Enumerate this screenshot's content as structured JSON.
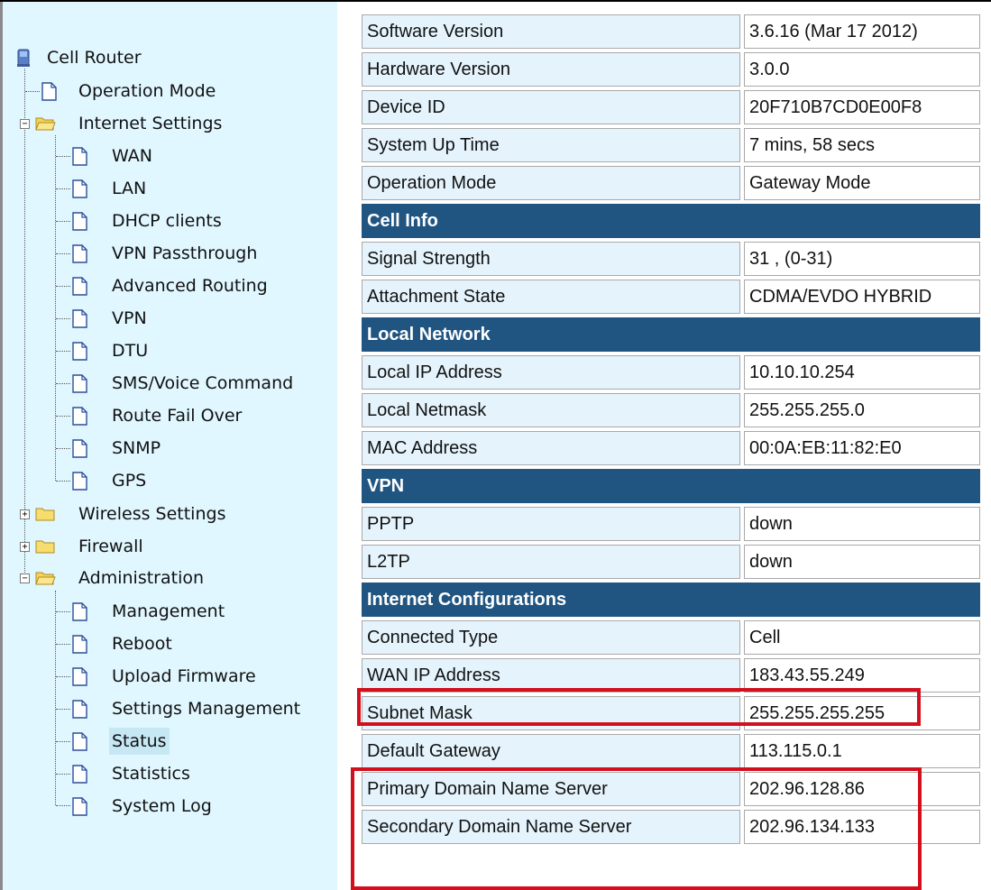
{
  "sidebar": {
    "root": "Cell Router",
    "items": [
      {
        "label": "Operation Mode"
      },
      {
        "label": "Internet Settings",
        "children": [
          "WAN",
          "LAN",
          "DHCP clients",
          "VPN Passthrough",
          "Advanced Routing",
          "VPN",
          "DTU",
          "SMS/Voice Command",
          "Route Fail Over",
          "SNMP",
          "GPS"
        ]
      },
      {
        "label": "Wireless Settings"
      },
      {
        "label": "Firewall"
      },
      {
        "label": "Administration",
        "children": [
          "Management",
          "Reboot",
          "Upload Firmware",
          "Settings Management",
          "Status",
          "Statistics",
          "System Log"
        ]
      }
    ],
    "selected": "Status"
  },
  "system_info": [
    {
      "label": "Software Version",
      "value": "3.6.16 (Mar 17 2012)"
    },
    {
      "label": "Hardware Version",
      "value": "3.0.0"
    },
    {
      "label": "Device ID",
      "value": "20F710B7CD0E00F8"
    },
    {
      "label": "System Up Time",
      "value": "7 mins, 58 secs"
    },
    {
      "label": "Operation Mode",
      "value": "Gateway Mode"
    }
  ],
  "cell_info": {
    "title": "Cell Info",
    "rows": [
      {
        "label": "Signal Strength",
        "value": "31 , (0-31)"
      },
      {
        "label": "Attachment State",
        "value": "CDMA/EVDO HYBRID"
      }
    ]
  },
  "local_network": {
    "title": "Local Network",
    "rows": [
      {
        "label": "Local IP Address",
        "value": "10.10.10.254"
      },
      {
        "label": "Local Netmask",
        "value": "255.255.255.0"
      },
      {
        "label": "MAC Address",
        "value": "00:0A:EB:11:82:E0"
      }
    ]
  },
  "vpn": {
    "title": "VPN",
    "rows": [
      {
        "label": "PPTP",
        "value": "down"
      },
      {
        "label": "L2TP",
        "value": "down"
      }
    ]
  },
  "internet_config": {
    "title": "Internet Configurations",
    "rows": [
      {
        "label": "Connected Type",
        "value": "Cell"
      },
      {
        "label": "WAN IP Address",
        "value": "183.43.55.249"
      },
      {
        "label": "Subnet Mask",
        "value": "255.255.255.255"
      },
      {
        "label": "Default Gateway",
        "value": "113.115.0.1"
      },
      {
        "label": "Primary Domain Name Server",
        "value": "202.96.128.86"
      },
      {
        "label": "Secondary Domain Name Server",
        "value": "202.96.134.133"
      }
    ]
  },
  "colors": {
    "sidebar_bg": "#e1f7ff",
    "section_header_bg": "#215581",
    "label_cell_bg": "#e5f4fc",
    "highlight_border": "#d2101d"
  }
}
